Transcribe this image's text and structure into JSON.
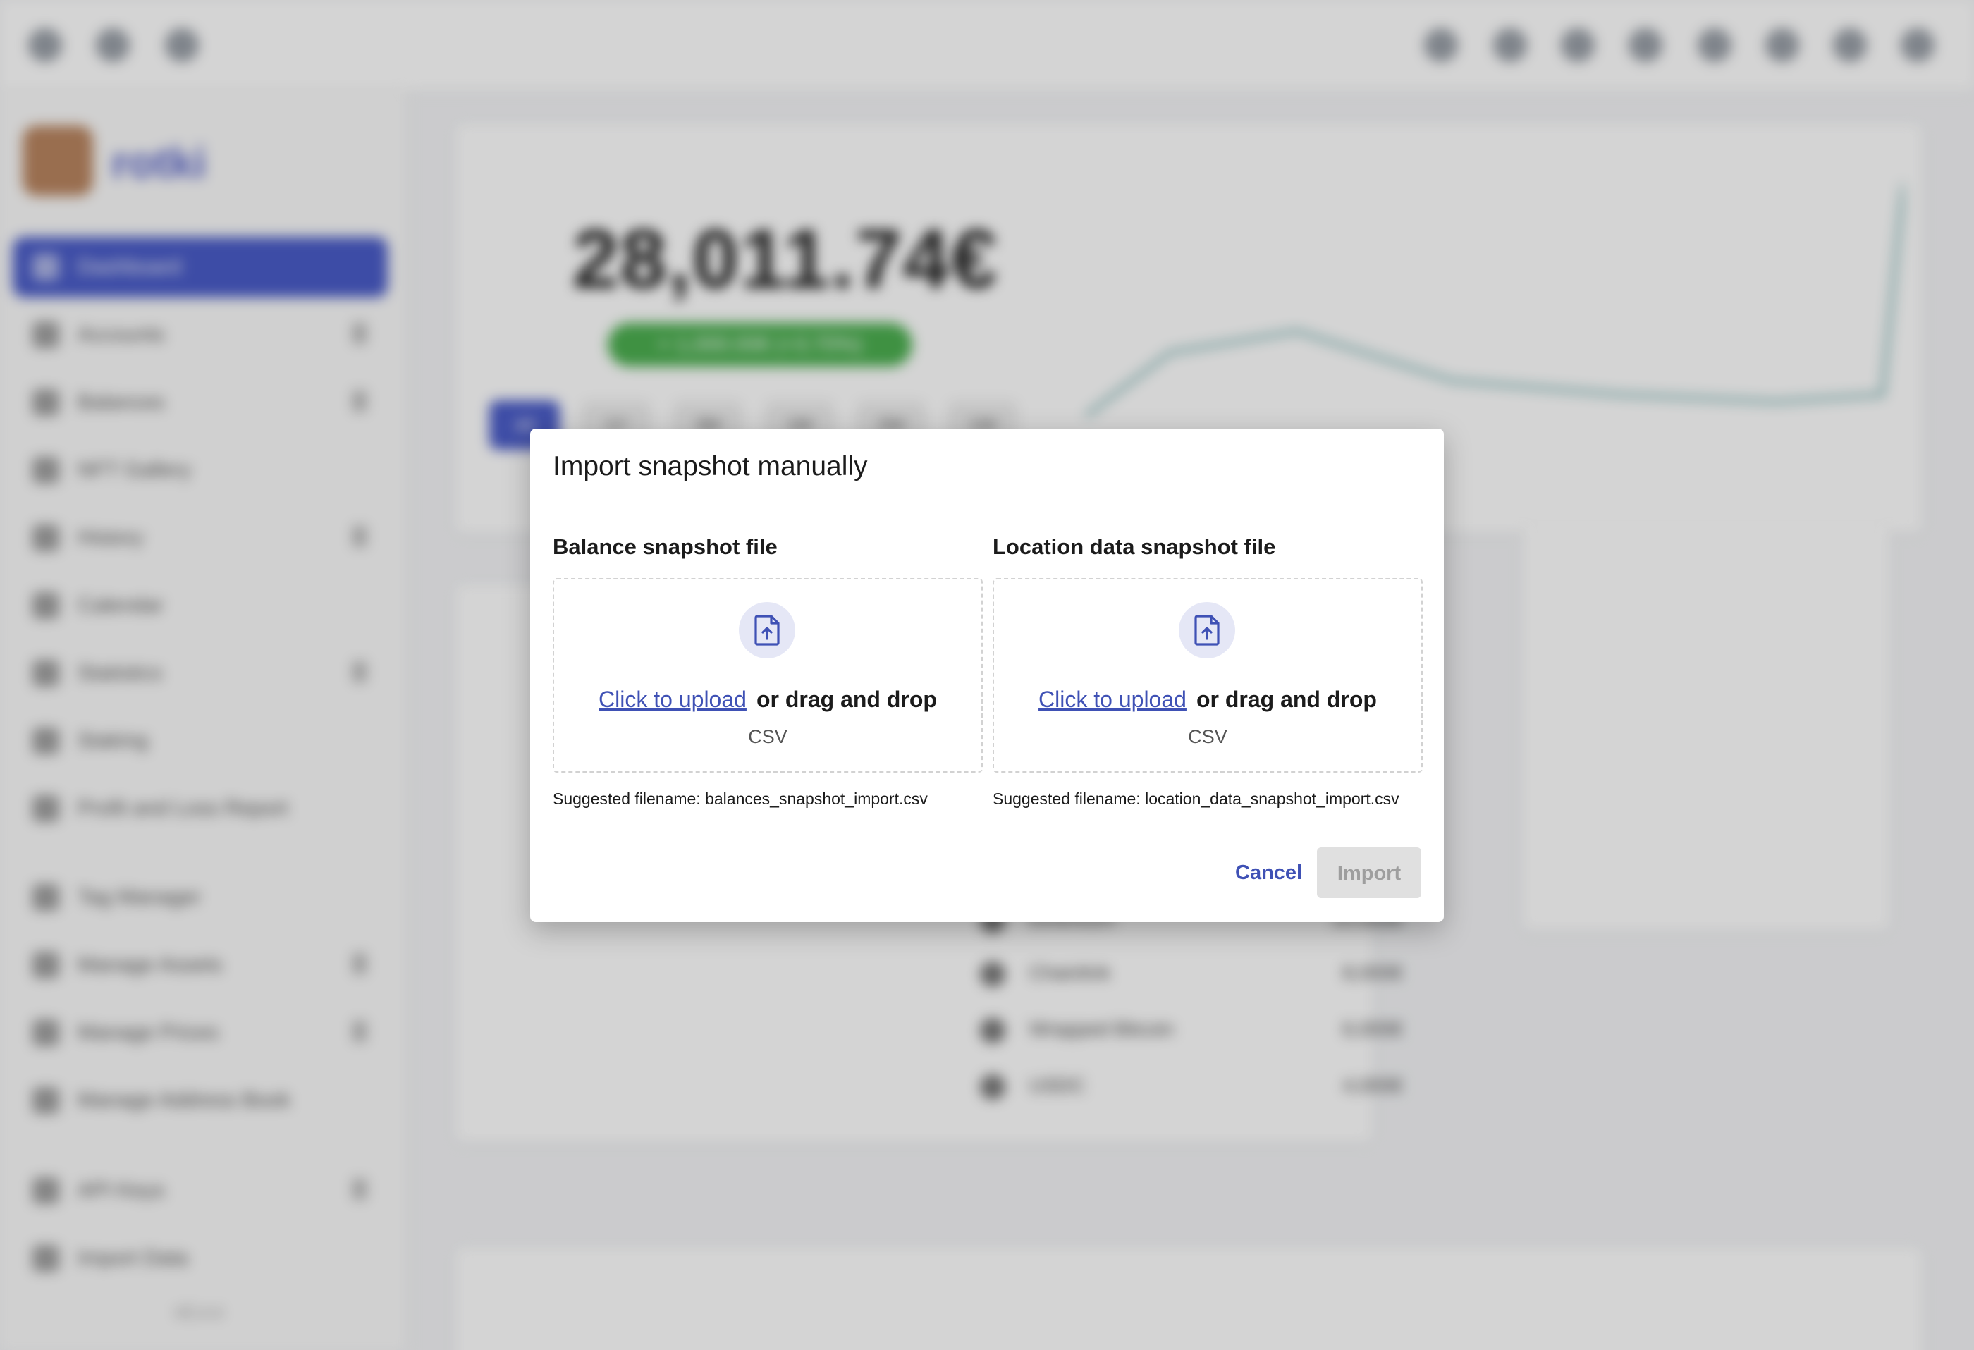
{
  "app": {
    "brand": "rotki",
    "version": "v1.x.x"
  },
  "sidebar": {
    "items": [
      {
        "label": "Dashboard",
        "active": true
      },
      {
        "label": "Accounts"
      },
      {
        "label": "Balances"
      },
      {
        "label": "NFT Gallery"
      },
      {
        "label": "History"
      },
      {
        "label": "Calendar"
      },
      {
        "label": "Statistics"
      },
      {
        "label": "Staking"
      },
      {
        "label": "Profit and Loss Report"
      },
      {
        "label": "Tag Manager"
      },
      {
        "label": "Manage Assets"
      },
      {
        "label": "Manage Prices"
      },
      {
        "label": "Manage Address Book"
      },
      {
        "label": "API Keys"
      },
      {
        "label": "Import Data"
      }
    ]
  },
  "dashboard": {
    "net_worth": "28,011.74€",
    "change_chip": "+ 1,000.00€ (+3.70%)",
    "ranges": [
      "All",
      "1Y",
      "3M",
      "1M",
      "2W",
      "1W"
    ],
    "assets": [
      {
        "name": "Ethereum",
        "value": "10,000€"
      },
      {
        "name": "Chainlink",
        "value": "8,000€"
      },
      {
        "name": "Wrapped Bitcoin",
        "value": "6,000€"
      },
      {
        "name": "USDC",
        "value": "4,000€"
      }
    ]
  },
  "dialog": {
    "title": "Import snapshot manually",
    "balance": {
      "heading": "Balance snapshot file",
      "link": "Click to upload",
      "drag": "or drag and drop",
      "type": "CSV",
      "suggested": "Suggested filename: balances_snapshot_import.csv"
    },
    "location": {
      "heading": "Location data snapshot file",
      "link": "Click to upload",
      "drag": "or drag and drop",
      "type": "CSV",
      "suggested": "Suggested filename: location_data_snapshot_import.csv"
    },
    "cancel": "Cancel",
    "import": "Import",
    "import_disabled": true
  },
  "colors": {
    "accent": "#3f51b5",
    "badge_bg": "#e5e7f6",
    "disabled_bg": "#e0e0e0",
    "disabled_text": "#9e9e9e"
  },
  "icons": {
    "upload": "file-upload-icon"
  }
}
